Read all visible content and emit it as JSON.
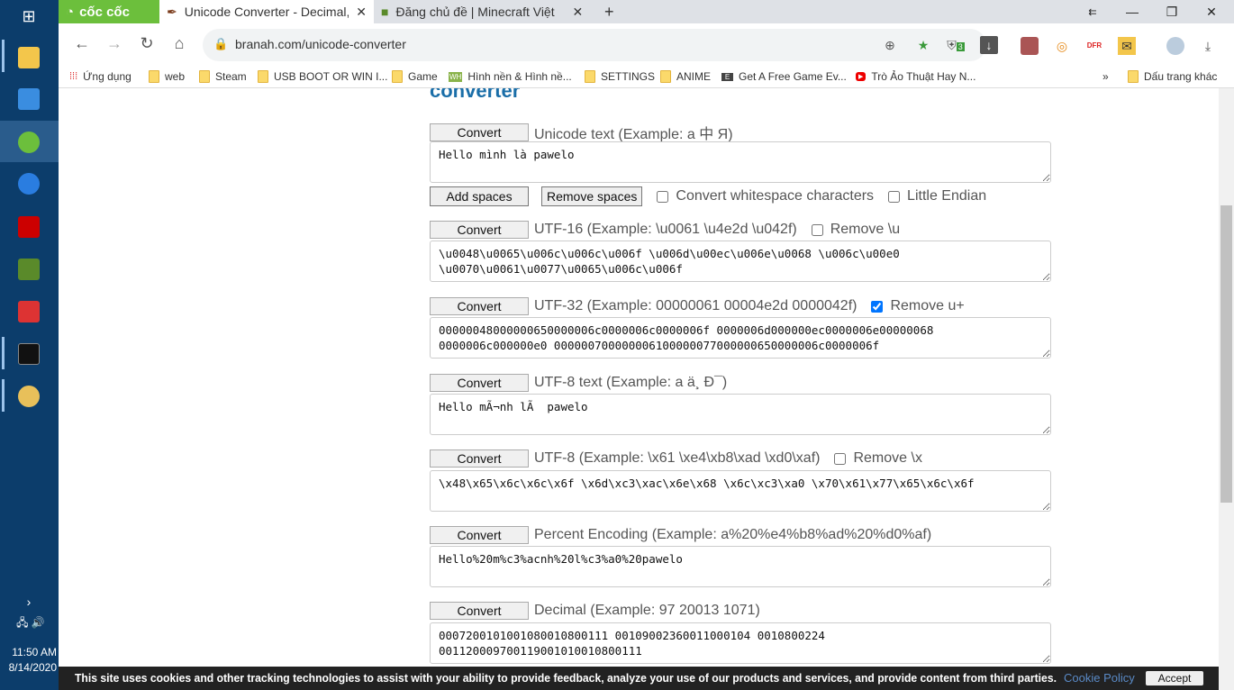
{
  "taskbar": {
    "time": "11:50 AM",
    "date": "8/14/2020"
  },
  "browser": {
    "brand": "cốc cốc",
    "tabs": [
      {
        "title": "Unicode Converter - Decimal,"
      },
      {
        "title": "Đăng chủ đề | Minecraft Việt"
      }
    ],
    "url": "branah.com/unicode-converter",
    "shield_badge": "3",
    "bookmarks": [
      "Ứng dụng",
      "web",
      "Steam",
      "USB BOOT OR WIN I...",
      "Game",
      "Hình nền & Hình nề...",
      "SETTINGS",
      "ANIME",
      "Get A Free Game Ev...",
      "Trò Ảo Thuật Hay N..."
    ],
    "other_bookmarks": "Dấu trang khác"
  },
  "page": {
    "heading": "converter",
    "convert": "Convert",
    "add_spaces": "Add spaces",
    "remove_spaces": "Remove spaces",
    "convert_ws": "Convert whitespace characters",
    "little_endian": "Little Endian",
    "sections": [
      {
        "label": "Unicode text (Example: a 中 Я)",
        "value": "Hello mình là pawelo"
      },
      {
        "label": "UTF-16 (Example: \\u0061 \\u4e2d \\u042f)",
        "option": "Remove \\u",
        "checked": false,
        "value": "\\u0048\\u0065\\u006c\\u006c\\u006f \\u006d\\u00ec\\u006e\\u0068 \\u006c\\u00e0\n\\u0070\\u0061\\u0077\\u0065\\u006c\\u006f"
      },
      {
        "label": "UTF-32 (Example: 00000061 00004e2d 0000042f)",
        "option": "Remove u+",
        "checked": true,
        "value": "0000004800000065000000 6c0000006c0000006f 0000006d000000ec0000006e00000068\n0000006c000000e0 000000700000006100000077000000650000006c0000006f"
      },
      {
        "label": "UTF-8 text (Example: a ä¸ Ð¯)",
        "value": "Hello mÃ¬nh lÃ  pawelo"
      },
      {
        "label": "UTF-8 (Example: \\x61 \\xe4\\xb8\\xad \\xd0\\xaf)",
        "option": "Remove \\x",
        "checked": false,
        "value": "\\x48\\x65\\x6c\\x6c\\x6f \\x6d\\xc3\\xac\\x6e\\x68 \\x6c\\xc3\\xa0 \\x70\\x61\\x77\\x65\\x6c\\x6f"
      },
      {
        "label": "Percent Encoding (Example: a%20%e4%b8%ad%20%d0%af)",
        "value": "Hello%20m%c3%acnh%20l%c3%a0%20pawelo"
      },
      {
        "label": "Decimal (Example: 97 20013 1071)",
        "value": "00072001010010800108001110 01090023600110001040010800224\n00112000970011900101001080 0111"
      }
    ]
  },
  "cookie": {
    "text": "This site uses cookies and other tracking technologies to assist with your ability to provide feedback, analyze your use of our products and services, and provide content from third parties.",
    "policy": "Cookie Policy",
    "accept": "Accept"
  }
}
